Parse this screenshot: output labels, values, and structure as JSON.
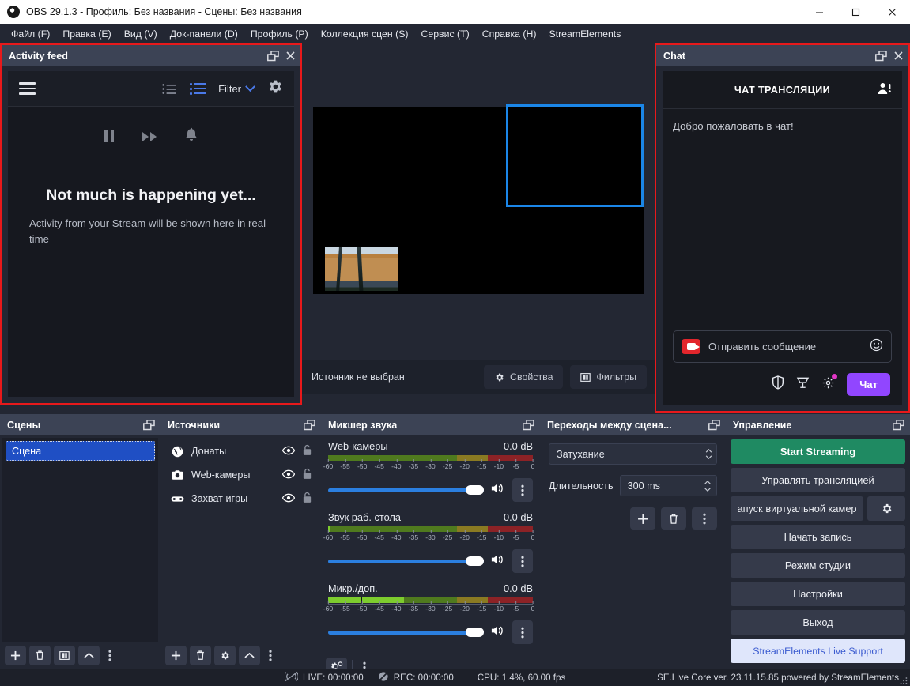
{
  "window": {
    "title": "OBS 29.1.3 - Профиль: Без названия - Сцены: Без названия",
    "logo_icon": "obs-logo-icon",
    "minimize_label": "—",
    "maximize_label": "▢",
    "close_label": "✕"
  },
  "menubar": {
    "items": [
      {
        "label": "Файл (F)",
        "name": "menu-file"
      },
      {
        "label": "Правка (E)",
        "name": "menu-edit"
      },
      {
        "label": "Вид (V)",
        "name": "menu-view"
      },
      {
        "label": "Док-панели (D)",
        "name": "menu-docks"
      },
      {
        "label": "Профиль (P)",
        "name": "menu-profile"
      },
      {
        "label": "Коллекция сцен (S)",
        "name": "menu-scene-collection"
      },
      {
        "label": "Сервис (T)",
        "name": "menu-tools"
      },
      {
        "label": "Справка (H)",
        "name": "menu-help"
      },
      {
        "label": "StreamElements",
        "name": "menu-streamelements"
      }
    ]
  },
  "activity_feed": {
    "title": "Activity feed",
    "float_icon": "float-window-icon",
    "close_icon": "close-icon",
    "menu_icon": "hamburger-menu-icon",
    "compact_view_icon": "compact-list-icon",
    "expanded_view_icon": "expanded-list-icon",
    "filter_label": "Filter",
    "filter_chevron_icon": "chevron-down-icon",
    "settings_icon": "gear-icon",
    "pause_icon": "pause-icon",
    "fastforward_icon": "fast-forward-icon",
    "bell_icon": "bell-icon",
    "empty_title": "Not much is happening yet...",
    "empty_subtitle": "Activity from your Stream will be shown here in real-time"
  },
  "chat": {
    "title": "Chat",
    "float_icon": "float-window-icon",
    "close_icon": "close-icon",
    "header_title": "ЧАТ ТРАНСЛЯЦИИ",
    "users_icon": "viewer-list-icon",
    "welcome_message": "Добро пожаловать в чат!",
    "input_placeholder": "Отправить сообщение",
    "camera_icon": "camera-badge-icon",
    "emoji_icon": "emoji-smiley-icon",
    "shield_icon": "shield-moderation-icon",
    "bits_icon": "bits-icon",
    "settings_icon": "gear-icon",
    "send_label": "Чат",
    "send_color": "#9146ff"
  },
  "preview": {
    "no_source_label": "Источник не выбран",
    "properties_label": "Свойства",
    "properties_icon": "gear-icon",
    "filters_label": "Фильтры",
    "filters_icon": "filters-icon",
    "selection_color": "#1b86e8"
  },
  "scenes": {
    "title": "Сцены",
    "float_icon": "float-window-icon",
    "items": [
      {
        "label": "Сцена",
        "selected": true
      }
    ],
    "toolbar": {
      "add_icon": "plus-icon",
      "remove_icon": "trash-icon",
      "filters_icon": "scene-filters-icon",
      "up_icon": "chevron-up-icon",
      "more_icon": "more-vertical-icon"
    }
  },
  "sources": {
    "title": "Источники",
    "float_icon": "float-window-icon",
    "items": [
      {
        "label": "Донаты",
        "icon": "browser-source-icon",
        "visible_icon": "eye-icon",
        "lock_icon": "unlock-icon"
      },
      {
        "label": "Web-камеры",
        "icon": "camera-source-icon",
        "visible_icon": "eye-icon",
        "lock_icon": "unlock-icon"
      },
      {
        "label": "Захват игры",
        "icon": "gamepad-source-icon",
        "visible_icon": "eye-icon",
        "lock_icon": "unlock-icon"
      }
    ],
    "toolbar": {
      "add_icon": "plus-icon",
      "remove_icon": "trash-icon",
      "properties_icon": "gear-icon",
      "up_icon": "chevron-up-icon",
      "more_icon": "more-vertical-icon"
    }
  },
  "mixer": {
    "title": "Микшер звука",
    "float_icon": "float-window-icon",
    "scale_ticks": [
      "-60",
      "-55",
      "-50",
      "-45",
      "-40",
      "-35",
      "-30",
      "-25",
      "-20",
      "-15",
      "-10",
      "-5",
      "0"
    ],
    "channels": [
      {
        "name": "Web-камеры",
        "db": "0.0 dB",
        "level_pct": 0,
        "volume_pct": 100,
        "volume_icon": "speaker-icon",
        "menu_icon": "more-vertical-icon"
      },
      {
        "name": "Звук раб. стола",
        "db": "0.0 dB",
        "level_pct": 1,
        "volume_pct": 100,
        "volume_icon": "speaker-icon",
        "menu_icon": "more-vertical-icon"
      },
      {
        "name": "Микр./доп.",
        "db": "0.0 dB",
        "level_pct": 37,
        "volume_pct": 100,
        "volume_icon": "speaker-icon",
        "menu_icon": "more-vertical-icon"
      }
    ],
    "toolbar": {
      "advanced_icon": "advanced-audio-icon",
      "more_icon": "more-vertical-icon"
    }
  },
  "transitions": {
    "title": "Переходы между сцена...",
    "float_icon": "float-window-icon",
    "transition_value": "Затухание",
    "duration_label": "Длительность",
    "duration_value": "300 ms",
    "add_icon": "plus-icon",
    "remove_icon": "trash-icon",
    "more_icon": "more-vertical-icon"
  },
  "controls": {
    "title": "Управление",
    "float_icon": "float-window-icon",
    "start_streaming_label": "Start Streaming",
    "start_streaming_color": "#1f8a62",
    "manage_broadcast_label": "Управлять трансляцией",
    "virtual_cam_label": "апуск виртуальной камер",
    "virtual_cam_settings_icon": "gear-icon",
    "start_recording_label": "Начать запись",
    "studio_mode_label": "Режим студии",
    "settings_label": "Настройки",
    "exit_label": "Выход",
    "support_label": "StreamElements Live Support",
    "support_color": "#3b5bd0"
  },
  "statusbar": {
    "live_icon": "stream-inactive-icon",
    "live_label": "LIVE: 00:00:00",
    "rec_icon": "record-inactive-icon",
    "rec_label": "REC: 00:00:00",
    "cpu_label": "CPU: 1.4%, 60.00 fps",
    "se_label": "SE.Live Core ver. 23.11.15.85 powered by StreamElements",
    "grip_icon": "resize-grip-icon"
  }
}
